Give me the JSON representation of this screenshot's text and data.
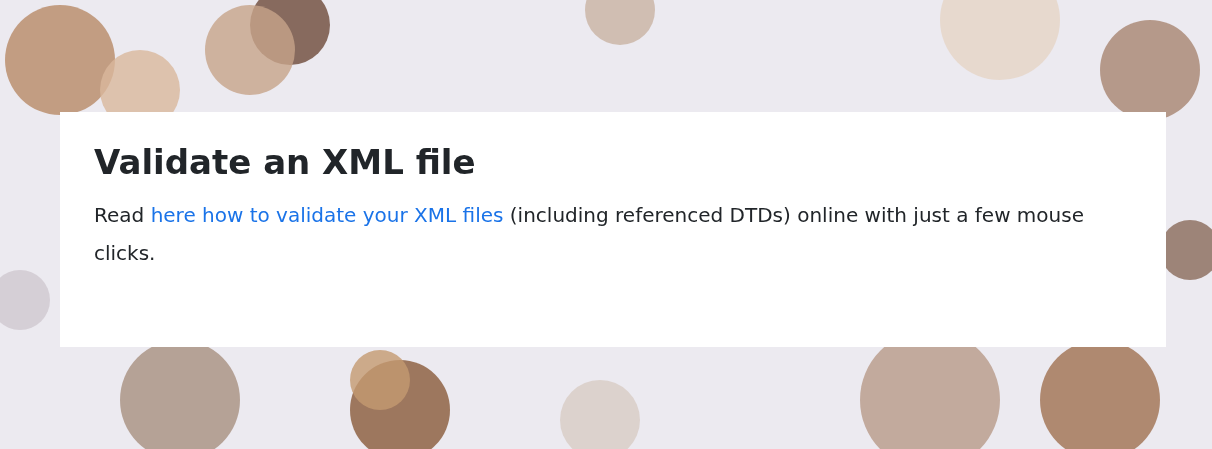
{
  "card": {
    "title": "Validate an XML file",
    "text_before": "Read ",
    "link": "here how to validate your XML files",
    "text_after": " (including referenced DTDs) online with just a few mouse clicks."
  }
}
